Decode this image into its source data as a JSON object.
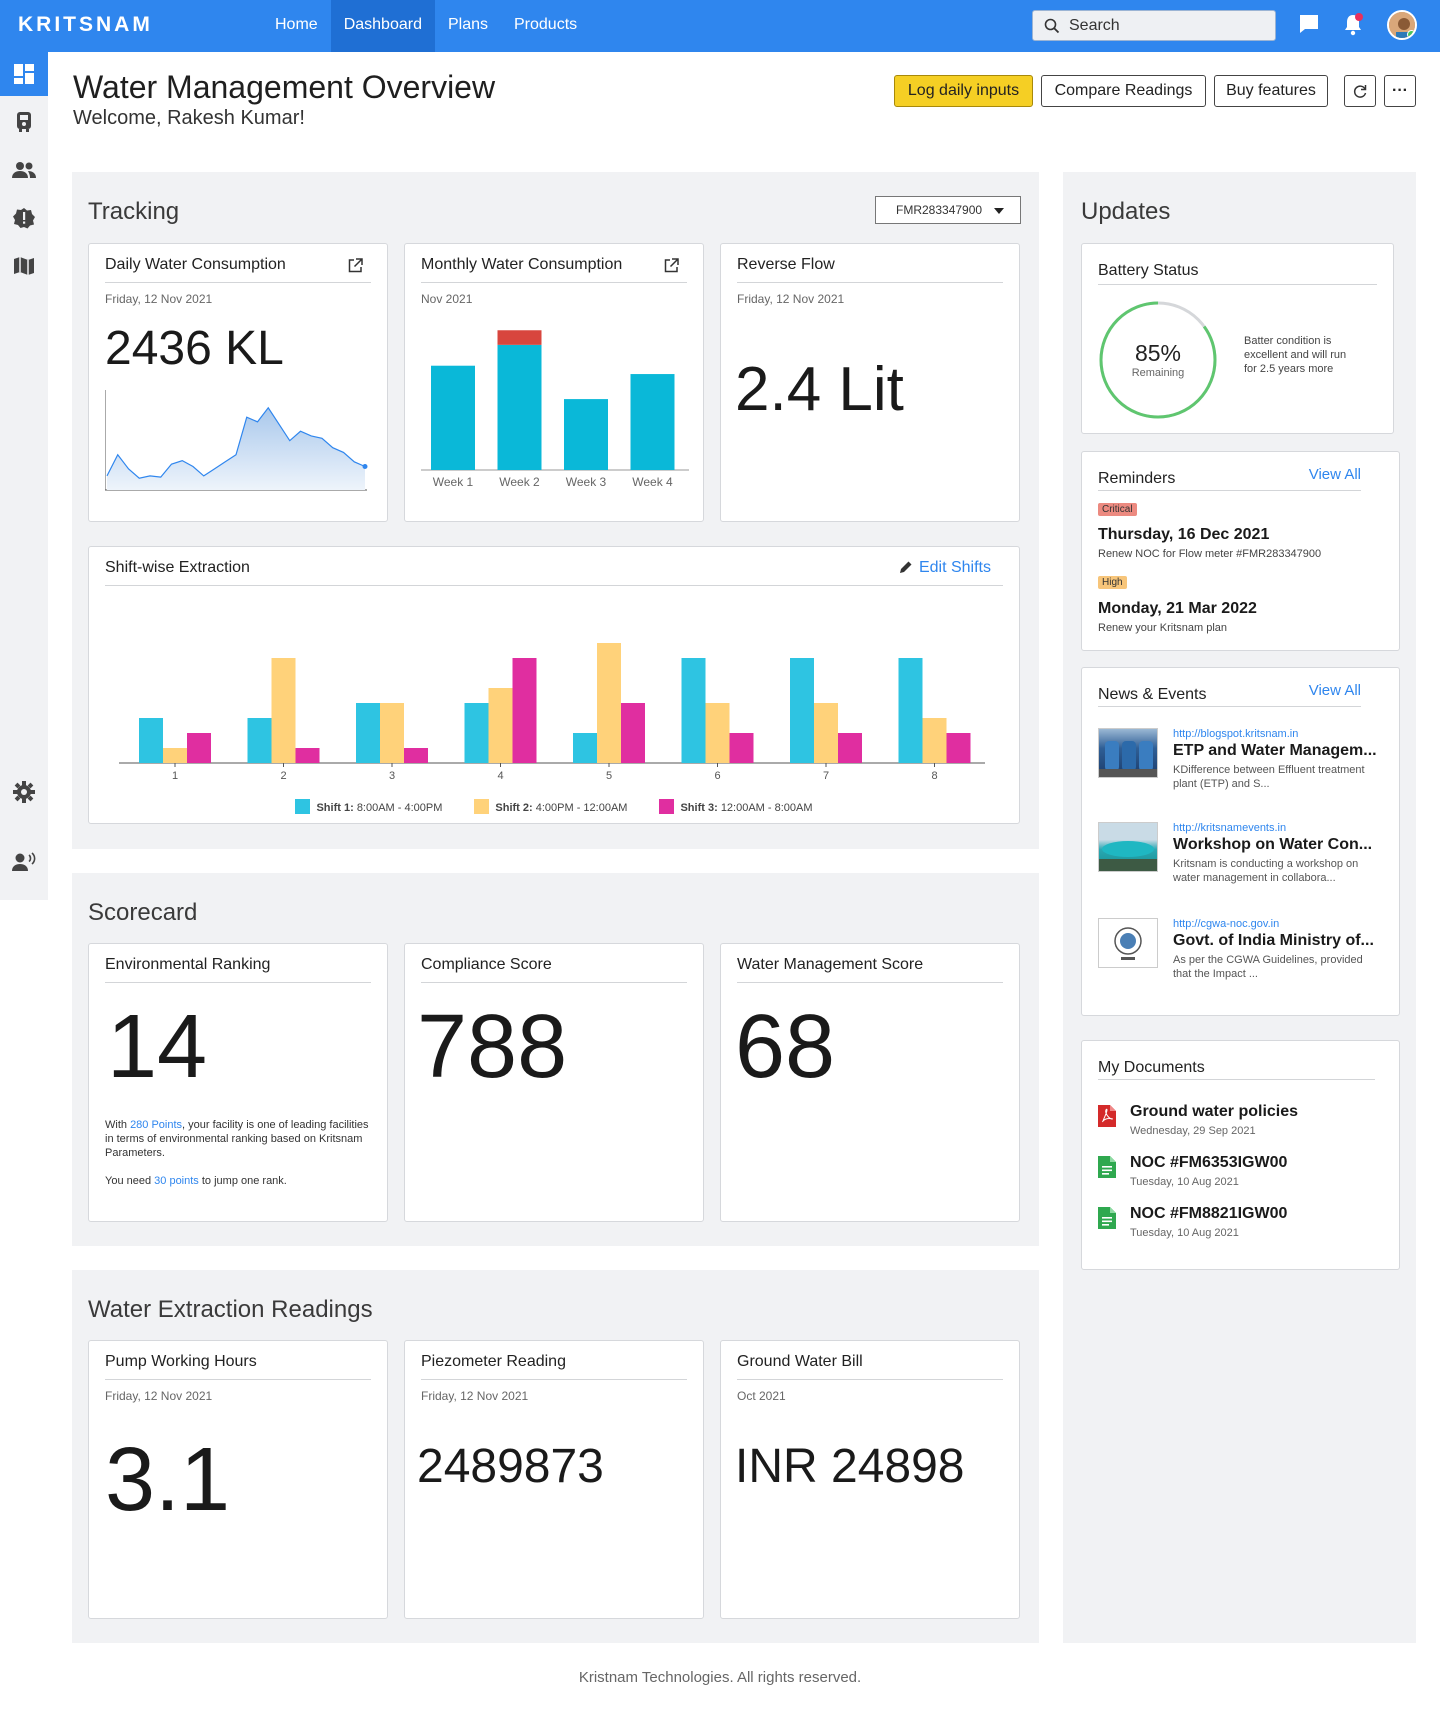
{
  "brand": "KRITSNAM",
  "nav": [
    "Home",
    "Dashboard",
    "Plans",
    "Products"
  ],
  "search_label": "Search",
  "page": {
    "title": "Water Management Overview",
    "welcome": "Welcome, Rakesh Kumar!"
  },
  "actions": {
    "log": "Log daily inputs",
    "compare": "Compare Readings",
    "buy": "Buy features",
    "more": "···"
  },
  "tracking": {
    "title": "Tracking",
    "meter": "FMR283347900",
    "daily": {
      "title": "Daily Water Consumption",
      "date": "Friday, 12 Nov 2021",
      "value": "2436 KL"
    },
    "monthly": {
      "title": "Monthly Water Consumption",
      "date": "Nov 2021"
    },
    "reverse": {
      "title": "Reverse Flow",
      "date": "Friday, 12 Nov 2021",
      "value": "2.4 Lit"
    },
    "shift": {
      "title": "Shift-wise Extraction",
      "edit": "Edit Shifts",
      "legend": [
        {
          "name": "Shift 1:",
          "range": "8:00AM - 4:00PM"
        },
        {
          "name": "Shift 2:",
          "range": "4:00PM - 12:00AM"
        },
        {
          "name": "Shift 3:",
          "range": "12:00AM - 8:00AM"
        }
      ]
    }
  },
  "chart_data": [
    {
      "type": "area",
      "x": [
        1,
        2,
        3,
        4,
        5,
        6,
        7,
        8,
        9,
        10,
        11,
        12,
        13,
        14,
        15,
        16,
        17,
        18,
        19,
        20,
        21,
        22,
        23,
        24,
        25
      ],
      "values": [
        12,
        30,
        18,
        10,
        12,
        11,
        22,
        25,
        20,
        12,
        18,
        24,
        30,
        62,
        58,
        70,
        56,
        42,
        50,
        46,
        44,
        36,
        32,
        24,
        20
      ],
      "color": "#2f86ee"
    },
    {
      "type": "bar",
      "categories": [
        "Week 1",
        "Week 2",
        "Week 3",
        "Week 4"
      ],
      "series": [
        {
          "values": [
            100,
            120,
            68,
            92
          ],
          "color": "#0ab8d8"
        },
        {
          "values": [
            0,
            14,
            0,
            0
          ],
          "color": "#d8463e"
        }
      ],
      "ylim": [
        0,
        140
      ]
    },
    {
      "type": "bar",
      "categories": [
        "1",
        "2",
        "3",
        "4",
        "5",
        "6",
        "7",
        "8"
      ],
      "series": [
        {
          "name": "Shift 1",
          "values": [
            3,
            3,
            4,
            4,
            2,
            7,
            7,
            7
          ],
          "color": "#2ec4e2"
        },
        {
          "name": "Shift 2",
          "values": [
            1,
            7,
            4,
            5,
            8,
            4,
            4,
            3
          ],
          "color": "#ffd27a"
        },
        {
          "name": "Shift 3",
          "values": [
            2,
            1,
            1,
            7,
            4,
            2,
            2,
            2
          ],
          "color": "#e02ea0"
        }
      ],
      "ylim": [
        0,
        8
      ],
      "xlabel": "",
      "ylabel": "",
      "legend": "bottom"
    }
  ],
  "scorecard": {
    "title": "Scorecard",
    "env": {
      "title": "Environmental Ranking",
      "value": "14",
      "t1": "With ",
      "points": "280 Points",
      "t2": ", your facility is one of leading facilities in terms of environmental ranking based on Kritsnam Parameters.",
      "t3": "You need ",
      "need": "30 points",
      "t4": " to jump one rank."
    },
    "compliance": {
      "title": "Compliance Score",
      "value": "788"
    },
    "wms": {
      "title": "Water Management Score",
      "value": "68"
    }
  },
  "extraction": {
    "title": "Water Extraction Readings",
    "pump": {
      "title": "Pump Working Hours",
      "date": "Friday, 12 Nov 2021",
      "value": "3.1"
    },
    "piezo": {
      "title": "Piezometer Reading",
      "date": "Friday, 12 Nov 2021",
      "value": "2489873"
    },
    "bill": {
      "title": "Ground Water Bill",
      "date": "Oct 2021",
      "value": "INR 24898"
    }
  },
  "updates": {
    "title": "Updates",
    "battery": {
      "title": "Battery Status",
      "pct": "85%",
      "sub": "Remaining",
      "level": 0.85,
      "note": "Batter condition is excellent and will run for 2.5 years more"
    },
    "reminders": {
      "title": "Reminders",
      "view_all": "View All",
      "items": [
        {
          "badge": "Critical",
          "date": "Thursday, 16 Dec 2021",
          "desc": "Renew NOC for Flow meter #FMR283347900"
        },
        {
          "badge": "High",
          "date": "Monday, 21 Mar 2022",
          "desc": "Renew your Kritsnam plan"
        }
      ]
    },
    "news": {
      "title": "News & Events",
      "view_all": "View All",
      "items": [
        {
          "url": "http://blogspot.kritsnam.in",
          "title": "ETP and Water Managem...",
          "desc": "KDifference between Effluent treatment plant (ETP) and S..."
        },
        {
          "url": "http://kritsnamevents.in",
          "title": "Workshop on Water Con...",
          "desc": "Kritsnam is conducting a workshop on water management in collabora..."
        },
        {
          "url": "http://cgwa-noc.gov.in",
          "title": "Govt. of India Ministry of...",
          "desc": "As per the CGWA Guidelines, provided that the Impact ..."
        }
      ]
    },
    "docs": {
      "title": "My Documents",
      "items": [
        {
          "title": "Ground water policies",
          "date": "Wednesday, 29 Sep 2021"
        },
        {
          "title": "NOC #FM6353IGW00",
          "date": "Tuesday, 10 Aug 2021"
        },
        {
          "title": "NOC #FM8821IGW00",
          "date": "Tuesday, 10 Aug 2021"
        }
      ]
    }
  },
  "footer": "Kristnam Technologies. All rights reserved."
}
